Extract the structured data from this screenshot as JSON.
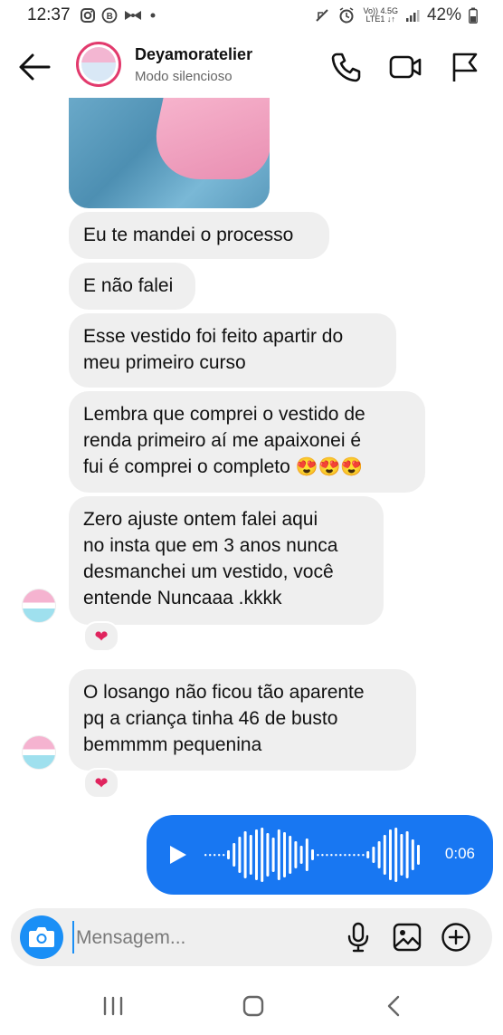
{
  "status_bar": {
    "time": "12:37",
    "net_top": "Vo)) 4.5G",
    "net_bottom": "LTE1 ↓↑",
    "battery": "42%"
  },
  "header": {
    "name": "Deyamoratelier",
    "status": "Modo silencioso"
  },
  "messages": [
    {
      "text": "Eu te mandei o processo"
    },
    {
      "text": "E não falei"
    },
    {
      "lines": [
        "Esse vestido foi feito apartir do",
        "meu primeiro curso"
      ]
    },
    {
      "lines": [
        "Lembra que comprei  o vestido  de",
        "renda primeiro  aí me apaixonei  é",
        "fui é comprei  o completo"
      ],
      "emoji": "😍😍😍"
    },
    {
      "lines": [
        "Zero ajuste ontem falei aqui",
        "no insta que em 3 anos nunca",
        "desmanchei um vestido, você",
        "entende Nuncaaa .kkkk"
      ],
      "reaction": "❤"
    },
    {
      "lines": [
        "O losango não ficou tão aparente",
        "pq a criança tinha 46 de busto",
        "bemmmm pequenina"
      ],
      "reaction": "❤"
    }
  ],
  "voice_message": {
    "duration": "0:06",
    "bubble_color": "#1877f2"
  },
  "composer": {
    "placeholder": "Mensagem..."
  },
  "icons": {
    "header": [
      "back-arrow-icon",
      "phone-icon",
      "video-camera-icon",
      "flag-icon"
    ],
    "composer": [
      "camera-icon",
      "microphone-icon",
      "gallery-icon",
      "plus-circle-icon"
    ],
    "nav": [
      "recent-apps-icon",
      "home-icon",
      "back-icon"
    ]
  }
}
